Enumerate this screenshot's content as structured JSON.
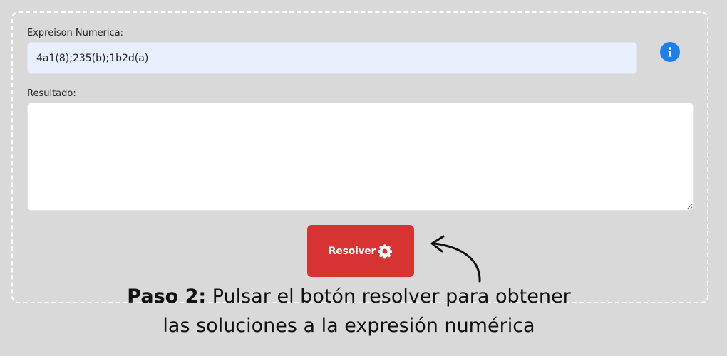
{
  "form": {
    "expression_label": "Expreison Numerica:",
    "expression_value": "4a1(8);235(b);1b2d(a)",
    "result_label": "Resultado:",
    "result_value": "",
    "info_icon": "info-icon",
    "solve_label": "Resolver",
    "solve_icon": "gear-icon"
  },
  "caption": {
    "step": "Paso 2:",
    "text_line1": "Pulsar el botón resolver para obtener",
    "text_line2": "las soluciones a la expresión numérica"
  },
  "colors": {
    "background": "#d9d9d9",
    "input_background": "#e8f0fe",
    "button": "#d73333",
    "info": "#1e7ff0"
  }
}
